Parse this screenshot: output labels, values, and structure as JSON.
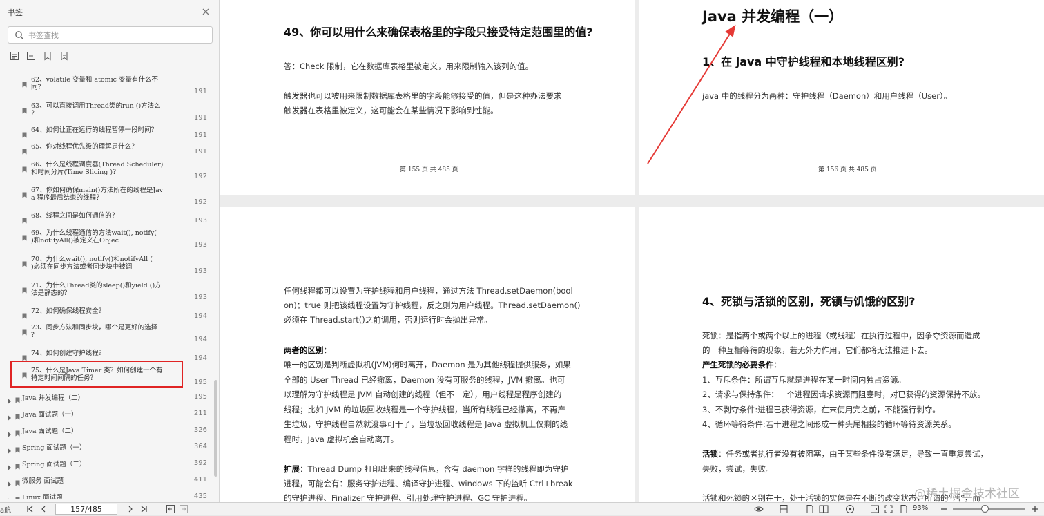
{
  "sidebar": {
    "title": "书签",
    "search_placeholder": "书签查找",
    "toc_items": [
      {
        "line1": "62、volatile 变量和 atomic 变量有什么不",
        "line2": "同？",
        "page": "191"
      },
      {
        "line1": "63、可以直接调用Thread类的run ()方法么",
        "line2": "？",
        "page": "191"
      },
      {
        "line1": "64、如何让正在运行的线程暂停一段时间？",
        "line2": "",
        "page": "191"
      },
      {
        "line1": "65、你对线程优先级的理解是什么？",
        "line2": "",
        "page": "191"
      },
      {
        "line1": "66、什么是线程调度器(Thread Scheduler)",
        "line2": "和时间分片(Time Slicing )？",
        "page": "192"
      },
      {
        "line1": "67、你如何确保main()方法所在的线程是Jav",
        "line2": "a 程序最后结束的线程？",
        "page": "192"
      },
      {
        "line1": "68、线程之间是如何通信的？",
        "line2": "",
        "page": "193"
      },
      {
        "line1": "69、为什么线程通信的方法wait(), notify(",
        "line2": ")和notifyAll()被定义在Objec",
        "page": "193"
      },
      {
        "line1": "70、为什么wait(), notify()和notifyAll (",
        "line2": ")必须在同步方法或者同步块中被调",
        "page": "193"
      },
      {
        "line1": "71、为什么Thread类的sleep()和yield ()方",
        "line2": "法是静态的？",
        "page": "193"
      },
      {
        "line1": "72、如何确保线程安全？",
        "line2": "",
        "page": "194"
      },
      {
        "line1": "73、同步方法和同步块，哪个是更好的选择",
        "line2": "？",
        "page": "194"
      },
      {
        "line1": "74、如何创建守护线程？",
        "line2": "",
        "page": "194"
      },
      {
        "line1": "75、什么是Java Timer 类？如何创建一个有",
        "line2": "特定时间间隔的任务？",
        "page": "195"
      }
    ],
    "toc_groups": [
      {
        "title": "Java 并发编程（二）",
        "page": "195"
      },
      {
        "title": "Java 面试题（一）",
        "page": "211"
      },
      {
        "title": "Java 面试题（二）",
        "page": "326"
      },
      {
        "title": "Spring 面试题（一）",
        "page": "364"
      },
      {
        "title": "Spring 面试题（二）",
        "page": "392"
      },
      {
        "title": "微服务 面试题",
        "page": "411"
      },
      {
        "title": "Linux 面试题",
        "page": "435"
      }
    ]
  },
  "pages": {
    "p155": {
      "heading": "49、你可以用什么来确保表格里的字段只接受特定范围里的值?",
      "para1": "答：Check 限制，它在数据库表格里被定义，用来限制输入该列的值。",
      "para2a": "触发器也可以被用来限制数据库表格里的字段能够接受的值，但是这种办法要求",
      "para2b": "触发器在表格里被定义，这可能会在某些情况下影响到性能。",
      "footer": "第 155 页 共 485 页"
    },
    "p156": {
      "title": "Java 并发编程（一）",
      "heading": "1、在 java 中守护线程和本地线程区别?",
      "para": "java 中的线程分为两种：守护线程（Daemon）和用户线程（User）。",
      "footer": "第 156 页 共 485 页"
    },
    "p157": {
      "l1": "任何线程都可以设置为守护线程和用户线程，通过方法 Thread.setDaemon(bool",
      "l2": "on)；true 则把该线程设置为守护线程，反之则为用户线程。Thread.setDaemon()",
      "l3": "必须在 Thread.start()之前调用，否则运行时会抛出异常。",
      "diff_label": "两者的区别",
      "diff_colon": "：",
      "d1": "唯一的区别是判断虚拟机(JVM)何时离开，Daemon 是为其他线程提供服务，如果",
      "d2": "全部的 User Thread 已经撤离，Daemon 没有可服务的线程，JVM 撤离。也可",
      "d3": "以理解为守护线程是 JVM 自动创建的线程（但不一定），用户线程是程序创建的",
      "d4": "线程；比如 JVM 的垃圾回收线程是一个守护线程，当所有线程已经撤离，不再产",
      "d5": "生垃圾，守护线程自然就没事可干了，当垃圾回收线程是 Java 虚拟机上仅剩的线",
      "d6": "程时，Java 虚拟机会自动离开。",
      "ext_label": "扩展",
      "e1": "：Thread Dump 打印出来的线程信息，含有 daemon 字样的线程即为守护",
      "e2": "进程，可能会有：服务守护进程、编译守护进程、windows 下的监听 Ctrl+break",
      "e3": "的守护进程、Finalizer 守护进程、引用处理守护进程、GC 守护进程。"
    },
    "p158": {
      "heading": "4、死锁与活锁的区别，死锁与饥饿的区别?",
      "s1": "死锁：是指两个或两个以上的进程（或线程）在执行过程中，因争夺资源而造成",
      "s2": "的一种互相等待的现象，若无外力作用，它们都将无法推进下去。",
      "cond_label": "产生死锁的必要条件",
      "cond_colon": "：",
      "c1": "1、互斥条件：所谓互斥就是进程在某一时间内独占资源。",
      "c2": "2、请求与保持条件：一个进程因请求资源而阻塞时，对已获得的资源保持不放。",
      "c3": "3、不剥夺条件:进程已获得资源，在末使用完之前，不能强行剥夺。",
      "c4": "4、循环等待条件:若干进程之间形成一种头尾相接的循环等待资源关系。",
      "live_label": "活锁",
      "lv1": "：任务或者执行者没有被阻塞，由于某些条件没有满足，导致一直重复尝试，",
      "lv2": "失败，尝试，失败。",
      "lv3": "活锁和死锁的区别在于，处于活锁的实体是在不断的改变状态，所谓的“活”，而"
    }
  },
  "watermark": "@稀土掘金技术社区",
  "statusbar": {
    "left_text": "a航",
    "page_value": "157/485",
    "zoom": "93%",
    "zoom_level": 0.45
  },
  "colors": {
    "highlight": "#e02424",
    "arrow": "#e53935"
  }
}
